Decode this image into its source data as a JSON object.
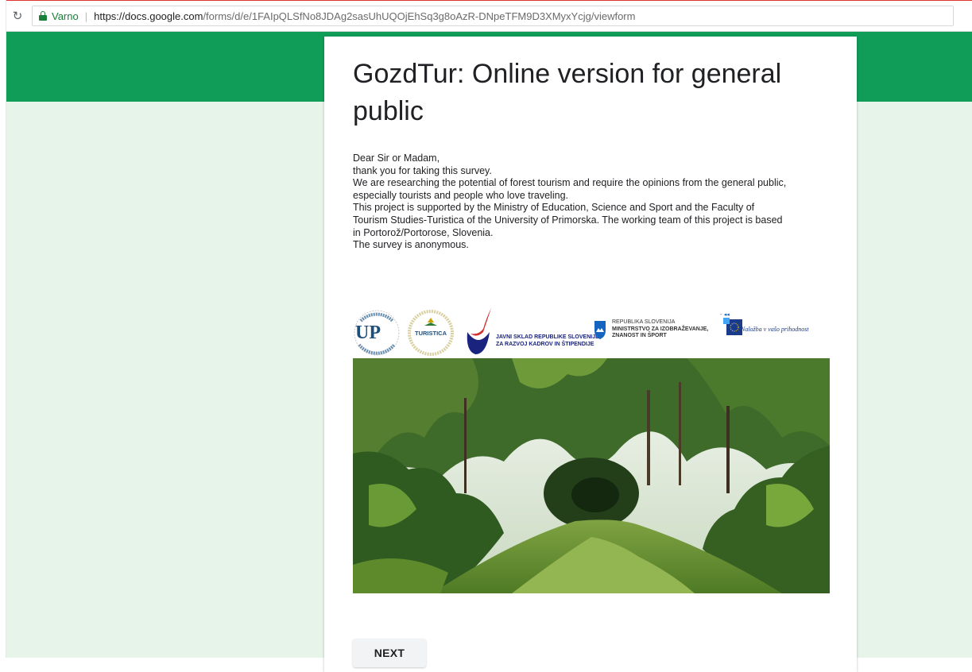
{
  "browser": {
    "secure_label": "Varno",
    "url_host": "https://docs.google.com",
    "url_path": "/forms/d/e/1FAIpQLSfNo8JDAg2sasUhUQOjEhSq3g8oAzR-DNpeTFM9D3XMyxYcjg/viewform"
  },
  "form": {
    "title": "GozdTur: Online version for general public",
    "description_lines": [
      "Dear Sir or Madam,",
      "thank you for taking this survey.",
      "We are researching the potential of forest tourism and require the opinions from the general public,",
      "especially tourists and people who love traveling.",
      "This project is supported by the Ministry of Education, Science and Sport and the Faculty of",
      "Tourism Studies-Turistica of the University of Primorska. The working team of this project is  based",
      "in Portorož/Portorose, Slovenia.",
      "The survey is anonymous."
    ],
    "next_label": "NEXT"
  },
  "logos": {
    "up": "UP",
    "turistica": "TURISTICA",
    "jsk_line1": "JAVNI SKLAD REPUBLIKE SLOVENIJE",
    "jsk_line2": "ZA RAZVOJ KADROV IN ŠTIPENDIJE",
    "mizs_line1": "REPUBLIKA SLOVENIJA",
    "mizs_line2": "MINISTRSTVO ZA IZOBRAŽEVANJE,",
    "mizs_line3": "ZNANOST IN ŠPORT",
    "eu_text": "Naložba v vašo prihodnost"
  },
  "colors": {
    "theme_green": "#0f9d58",
    "page_bg": "#e6f4ea"
  }
}
